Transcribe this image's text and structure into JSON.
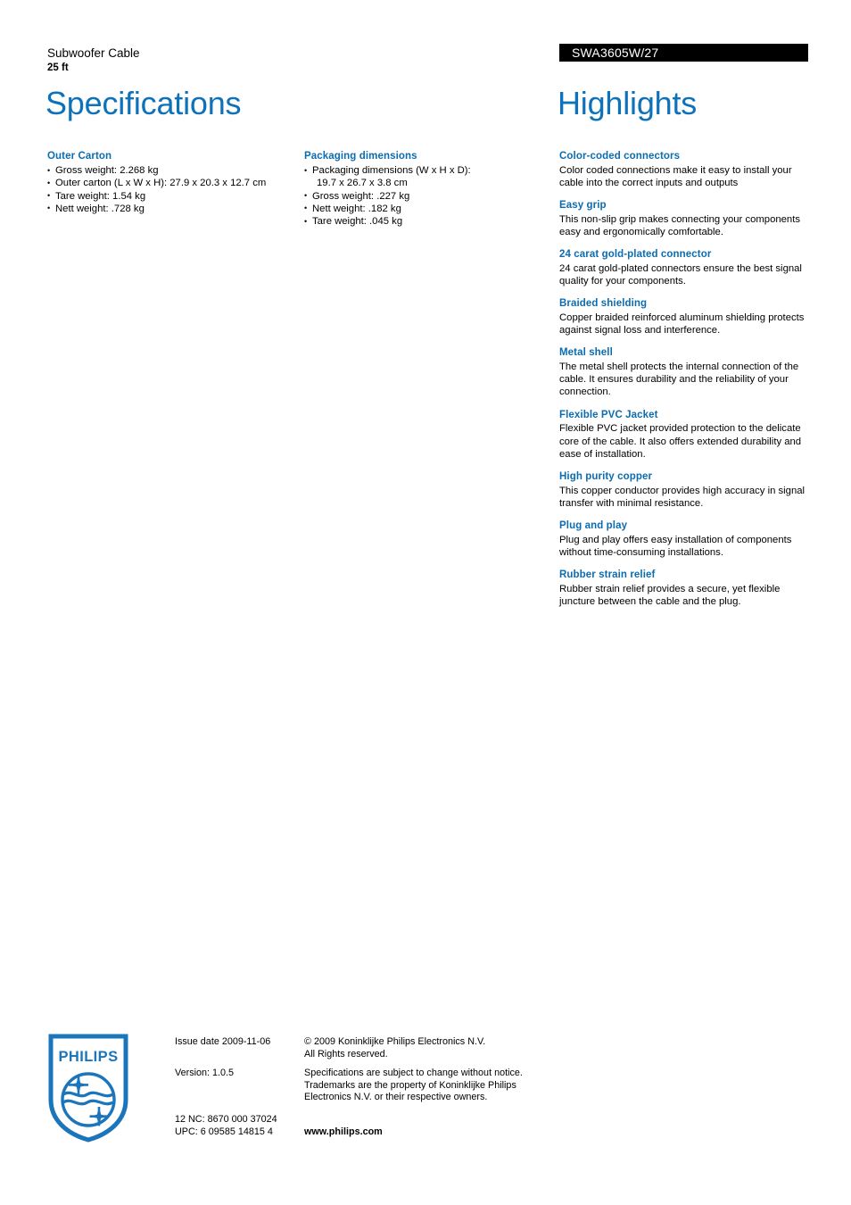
{
  "header": {
    "product_name": "Subwoofer Cable",
    "product_length": "25 ft",
    "product_code": "SWA3605W/27",
    "title_left": "Specifications",
    "title_right": "Highlights"
  },
  "colors": {
    "accent_blue": "#0b6cb0",
    "title_blue": "#0d72b9",
    "code_bar_bg": "#000000",
    "text": "#000000"
  },
  "specifications": {
    "column_1": [
      {
        "heading": "Outer Carton",
        "items": [
          "Gross weight: 2.268 kg",
          "Outer carton (L x W x H): 27.9 x 20.3 x 12.7 cm",
          "Tare weight: 1.54 kg",
          "Nett weight: .728 kg"
        ]
      }
    ],
    "column_2": [
      {
        "heading": "Packaging dimensions",
        "items": [
          "Packaging dimensions (W x H x D):",
          "Gross weight: .227 kg",
          "Nett weight: .182 kg",
          "Tare weight: .045 kg"
        ],
        "item_0_continuation": "19.7 x 26.7 x 3.8 cm"
      }
    ]
  },
  "highlights": [
    {
      "title": "Color-coded connectors",
      "description": "Color coded connections make it easy to install your cable into the correct inputs and outputs"
    },
    {
      "title": "Easy grip",
      "description": "This non-slip grip makes connecting your components easy and ergonomically comfortable."
    },
    {
      "title": "24 carat gold-plated connector",
      "description": "24 carat gold-plated connectors ensure the best signal quality for your components."
    },
    {
      "title": "Braided shielding",
      "description": "Copper braided reinforced aluminum shielding protects against signal loss and interference."
    },
    {
      "title": "Metal shell",
      "description": "The metal shell protects the internal connection of the cable. It ensures durability and the reliability of your connection."
    },
    {
      "title": "Flexible PVC Jacket",
      "description": "Flexible PVC jacket provided protection to the delicate core of the cable. It also offers extended durability and ease of installation."
    },
    {
      "title": "High purity copper",
      "description": "This copper conductor provides high accuracy in signal transfer with minimal resistance."
    },
    {
      "title": "Plug and play",
      "description": "Plug and play offers easy installation of components without time-consuming installations."
    },
    {
      "title": "Rubber strain relief",
      "description": "Rubber strain relief provides a secure, yet flexible juncture between the cable and the plug."
    }
  ],
  "footer": {
    "logo_wordmark": "PHILIPS",
    "issue_date": "Issue date 2009-11-06",
    "version": "Version: 1.0.5",
    "twelve_nc": "12 NC: 8670 000 37024",
    "upc": "UPC: 6 09585 14815 4",
    "copyright_line1": "© 2009 Koninklijke Philips Electronics N.V.",
    "copyright_line2": "All Rights reserved.",
    "disclaimer": "Specifications are subject to change without notice. Trademarks are the property of Koninklijke Philips Electronics N.V. or their respective owners.",
    "website": "www.philips.com"
  }
}
